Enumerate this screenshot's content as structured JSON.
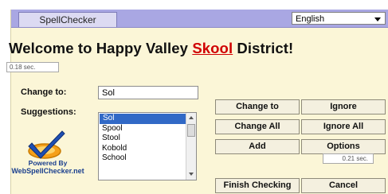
{
  "tab_label": "SpellChecker",
  "language": {
    "selected": "English"
  },
  "document": {
    "text_before": "Welcome to Happy Valley ",
    "misspelled_word": "Skool",
    "text_after": " District!"
  },
  "timers": {
    "top": "0.18 sec.",
    "bottom": "0.21 sec."
  },
  "change_to": {
    "label": "Change to:",
    "value": "Sol"
  },
  "suggestions": {
    "label": "Suggestions:",
    "items": [
      "Sol",
      "Spool",
      "Stool",
      "Kobold",
      "School"
    ],
    "selected_index": 0
  },
  "buttons": {
    "change_to": "Change to",
    "ignore": "Ignore",
    "change_all": "Change All",
    "ignore_all": "Ignore All",
    "add": "Add",
    "options": "Options",
    "finish": "Finish Checking",
    "cancel": "Cancel"
  },
  "branding": {
    "powered_by": "Powered By",
    "site": "WebSpellChecker.net"
  },
  "colors": {
    "header": "#a9a7e3",
    "panel": "#fbf6d7",
    "error": "#d00000",
    "selection": "#3169c6"
  }
}
